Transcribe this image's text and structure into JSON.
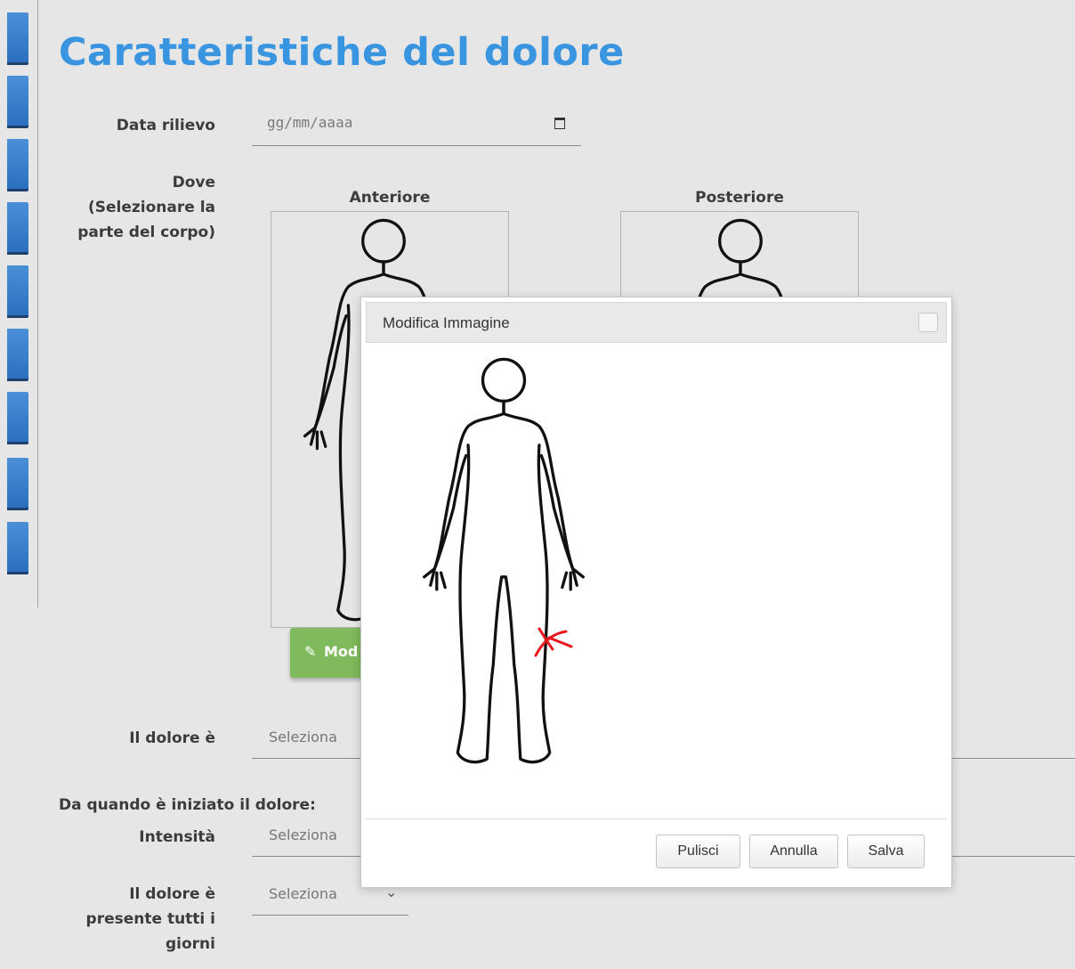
{
  "page": {
    "title": "Caratteristiche del dolore"
  },
  "form": {
    "date_label": "Data rilievo",
    "date_placeholder": "gg/mm/aaaa",
    "where_label_1": "Dove",
    "where_label_2": "(Selezionare la",
    "where_label_3": "parte del corpo)",
    "front_caption": "Anteriore",
    "back_caption": "Posteriore",
    "edit_button": "Mod",
    "pain_type_label": "Il dolore è",
    "pain_type_value": "Seleziona",
    "since_label": "Da quando è iniziato il dolore:",
    "intensity_label": "Intensità",
    "intensity_value": "Seleziona",
    "daily_label_1": "Il dolore è",
    "daily_label_2": "presente tutti i",
    "daily_label_3": "giorni",
    "daily_value": "Seleziona"
  },
  "dialog": {
    "title": "Modifica Immagine",
    "buttons": {
      "clear": "Pulisci",
      "cancel": "Annulla",
      "save": "Salva"
    },
    "mark_color": "#e8161b"
  },
  "icons": {
    "calendar": "calendar-icon",
    "chevron": "chevron-down-icon",
    "pencil": "pencil-icon",
    "close": "close-icon"
  },
  "colors": {
    "accent": "#3a95e0",
    "sidebar_tab": "#2c6fbf",
    "edit_button": "#7fba5c"
  }
}
